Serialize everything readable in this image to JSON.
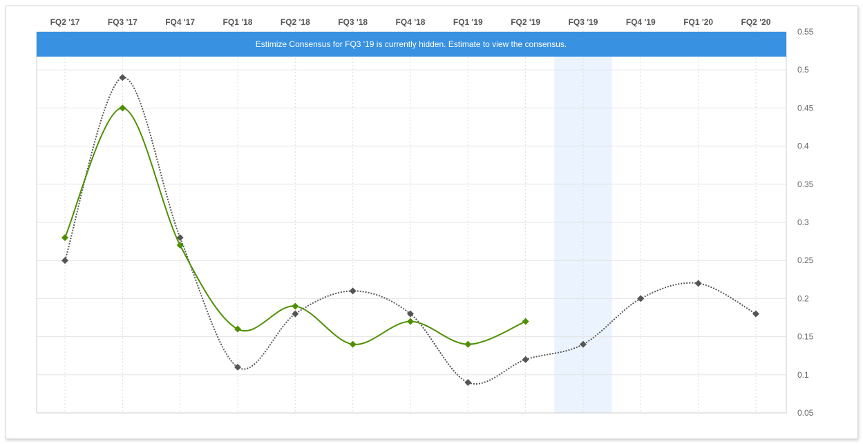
{
  "banner": {
    "text": "Estimize Consensus for FQ3 '19 is currently hidden. Estimate to view the consensus.",
    "color": "#3891e1"
  },
  "chart_data": {
    "type": "line",
    "categories": [
      "FQ2 '17",
      "FQ3 '17",
      "FQ4 '17",
      "FQ1 '18",
      "FQ2 '18",
      "FQ3 '18",
      "FQ4 '18",
      "FQ1 '19",
      "FQ2 '19",
      "FQ3 '19",
      "FQ4 '19",
      "FQ1 '20",
      "FQ2 '20"
    ],
    "yticks": [
      "0.05",
      "0.1",
      "0.15",
      "0.2",
      "0.25",
      "0.3",
      "0.35",
      "0.4",
      "0.45",
      "0.5",
      "0.55"
    ],
    "ylim": [
      0.05,
      0.55
    ],
    "y_axis_side": "right",
    "grid": true,
    "highlighted_category": "FQ3 '19",
    "highlight_color": "#eaf3fe",
    "series": [
      {
        "style": "dotted",
        "color": "#555555",
        "marker": "diamond",
        "values": [
          0.25,
          0.49,
          0.28,
          0.11,
          0.18,
          0.21,
          0.18,
          0.09,
          0.12,
          0.14,
          0.2,
          0.22,
          0.18
        ]
      },
      {
        "style": "solid",
        "color": "#4e8f00",
        "marker": "diamond",
        "values": [
          0.28,
          0.45,
          0.27,
          0.16,
          0.19,
          0.14,
          0.17,
          0.14,
          0.17,
          null,
          null,
          null,
          null
        ]
      }
    ]
  }
}
